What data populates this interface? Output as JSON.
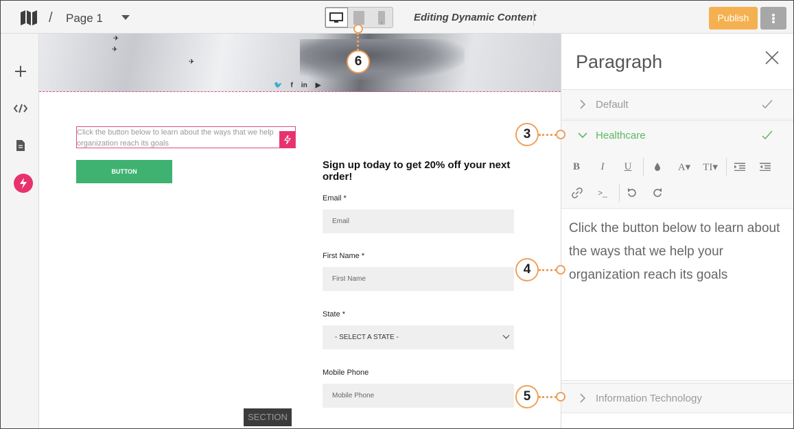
{
  "topbar": {
    "separator": "/",
    "page_name": "Page 1",
    "editing_label": "Editing Dynamic Content",
    "publish_label": "Publish"
  },
  "hero": {
    "social": [
      "twitter-icon",
      "facebook-icon",
      "linkedin-icon",
      "youtube-icon"
    ]
  },
  "content": {
    "paragraph_text": "Click the button below to learn about the ways that we help organization reach its goals",
    "button_label": "BUTTON"
  },
  "form": {
    "heading": "Sign up today to get 20% off your next order!",
    "fields": [
      {
        "label": "Email *",
        "placeholder": "Email"
      },
      {
        "label": "First Name *",
        "placeholder": "First Name"
      },
      {
        "label": "State *",
        "value": "- SELECT A STATE -"
      },
      {
        "label": "Mobile Phone",
        "placeholder": "Mobile Phone"
      }
    ]
  },
  "section_tag": "SECTION",
  "panel": {
    "title": "Paragraph",
    "accordion": [
      {
        "label": "Default"
      },
      {
        "label": "Healthcare"
      },
      {
        "label": "Information Technology"
      }
    ],
    "editor_text": "Click the button below to learn about the ways that we help your organization reach its goals"
  },
  "callouts": [
    "3",
    "4",
    "5",
    "6"
  ],
  "colors": {
    "accent_pink": "#e8326e",
    "publish_orange": "#f5b04f",
    "button_green": "#3fb271",
    "healthcare_green": "#5cb85c",
    "callout_orange": "#f0a05a"
  }
}
